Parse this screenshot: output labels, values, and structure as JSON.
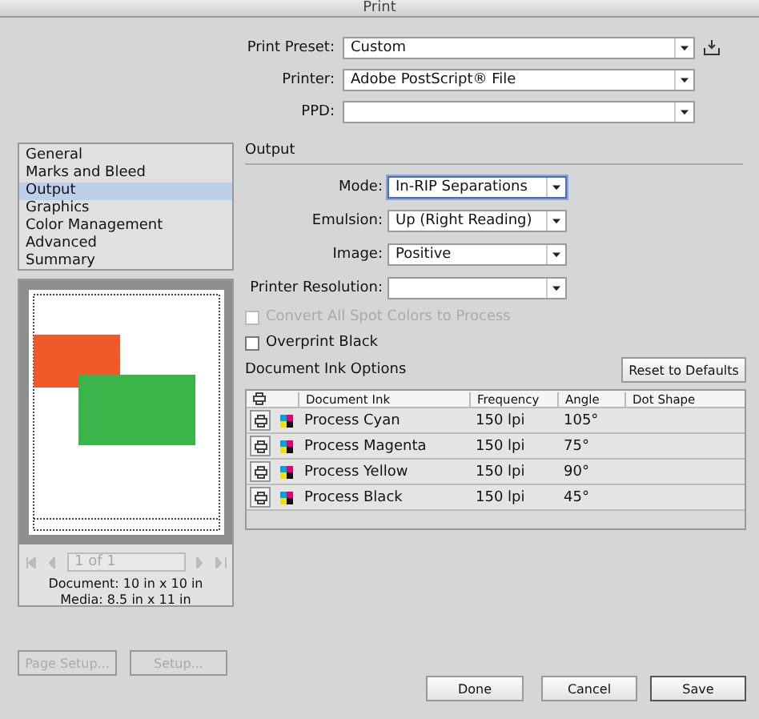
{
  "window": {
    "title": "Print"
  },
  "top_fields": [
    {
      "label": "Print Preset:",
      "value": "Custom"
    },
    {
      "label": "Printer:",
      "value": "Adobe PostScript® File"
    },
    {
      "label": "PPD:"
    }
  ],
  "categories": [
    {
      "label": "General",
      "selected": false
    },
    {
      "label": "Marks and Bleed",
      "selected": false
    },
    {
      "label": "Output",
      "selected": true
    },
    {
      "label": "Graphics",
      "selected": false
    },
    {
      "label": "Color Management",
      "selected": false
    },
    {
      "label": "Advanced",
      "selected": false
    },
    {
      "label": "Summary",
      "selected": false
    }
  ],
  "preview": {
    "page_field": "1 of 1",
    "document": "Document: 10 in x 10 in",
    "media": "Media: 8.5 in x 11 in"
  },
  "left_buttons": [
    {
      "label": "Page Setup...",
      "disabled": true
    },
    {
      "label": "Setup...",
      "disabled": true
    }
  ],
  "output": {
    "heading": "Output",
    "selects": [
      {
        "label": "Mode:",
        "value": "In-RIP Separations",
        "focused": true
      },
      {
        "label": "Emulsion:",
        "value": "Up (Right Reading)",
        "focused": false
      },
      {
        "label": "Image:",
        "value": "Positive",
        "focused": false
      },
      {
        "label": "Printer Resolution:",
        "focused": false
      }
    ],
    "checks": [
      {
        "label": "Convert All Spot Colors to Process",
        "checked": false,
        "disabled": true
      },
      {
        "label": "Overprint Black",
        "checked": false,
        "disabled": false
      }
    ],
    "ink_heading": "Document Ink Options",
    "reset": "Reset to Defaults",
    "columns": [
      "Document Ink",
      "Frequency",
      "Angle",
      "Dot Shape"
    ],
    "inks": [
      {
        "name": "Process Cyan",
        "frequency": "150 lpi",
        "angle": "105°",
        "print": true
      },
      {
        "name": "Process Magenta",
        "frequency": "150 lpi",
        "angle": "75°",
        "print": true
      },
      {
        "name": "Process Yellow",
        "frequency": "150 lpi",
        "angle": "90°",
        "print": true
      },
      {
        "name": "Process Black",
        "frequency": "150 lpi",
        "angle": "45°",
        "print": true
      }
    ]
  },
  "buttons": [
    {
      "label": "Done",
      "default": false
    },
    {
      "label": "Cancel",
      "default": false
    },
    {
      "label": "Save",
      "default": true
    }
  ]
}
